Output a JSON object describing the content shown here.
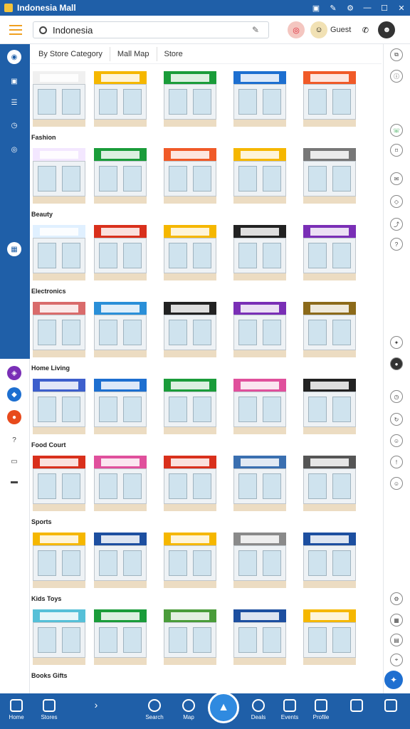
{
  "window": {
    "title": "Indonesia Mall"
  },
  "toolbar": {
    "search_value": "Indonesia",
    "user_name": "Guest"
  },
  "filters": [
    "By Store Category",
    "Mall Map",
    "Store"
  ],
  "rows": [
    {
      "label": "Fashion",
      "colors": [
        "#f0f0f0",
        "#f5b700",
        "#1a9c3a",
        "#1d6fd0",
        "#f05a28"
      ]
    },
    {
      "label": "Beauty",
      "colors": [
        "#f3e7ff",
        "#1a9c3a",
        "#f05a28",
        "#f5b700",
        "#777777"
      ]
    },
    {
      "label": "Electronics",
      "colors": [
        "#e0f0ff",
        "#d9301c",
        "#f5b700",
        "#222222",
        "#7a2fb6"
      ]
    },
    {
      "label": "Home Living",
      "colors": [
        "#d96b6b",
        "#2a8fd8",
        "#222222",
        "#7a2fb6",
        "#8c6a1a"
      ]
    },
    {
      "label": "Food Court",
      "colors": [
        "#3d5fcc",
        "#1d6fd0",
        "#1a9c3a",
        "#e0509c",
        "#222222"
      ]
    },
    {
      "label": "Sports",
      "colors": [
        "#d9301c",
        "#e0509c",
        "#d9301c",
        "#3a6fb0",
        "#555555"
      ]
    },
    {
      "label": "Kids Toys",
      "colors": [
        "#f5b700",
        "#1d4fa0",
        "#f5b700",
        "#8a8a8a",
        "#1d4fa0"
      ]
    },
    {
      "label": "Books Gifts",
      "colors": [
        "#56c0d8",
        "#1a9c3a",
        "#4a9c3a",
        "#1d4fa0",
        "#f5b700"
      ]
    }
  ],
  "bottom_nav": [
    "Home",
    "Stores",
    "Search",
    "Map",
    "Deals",
    "Events",
    "Profile"
  ],
  "accent": "#1f5fa8"
}
